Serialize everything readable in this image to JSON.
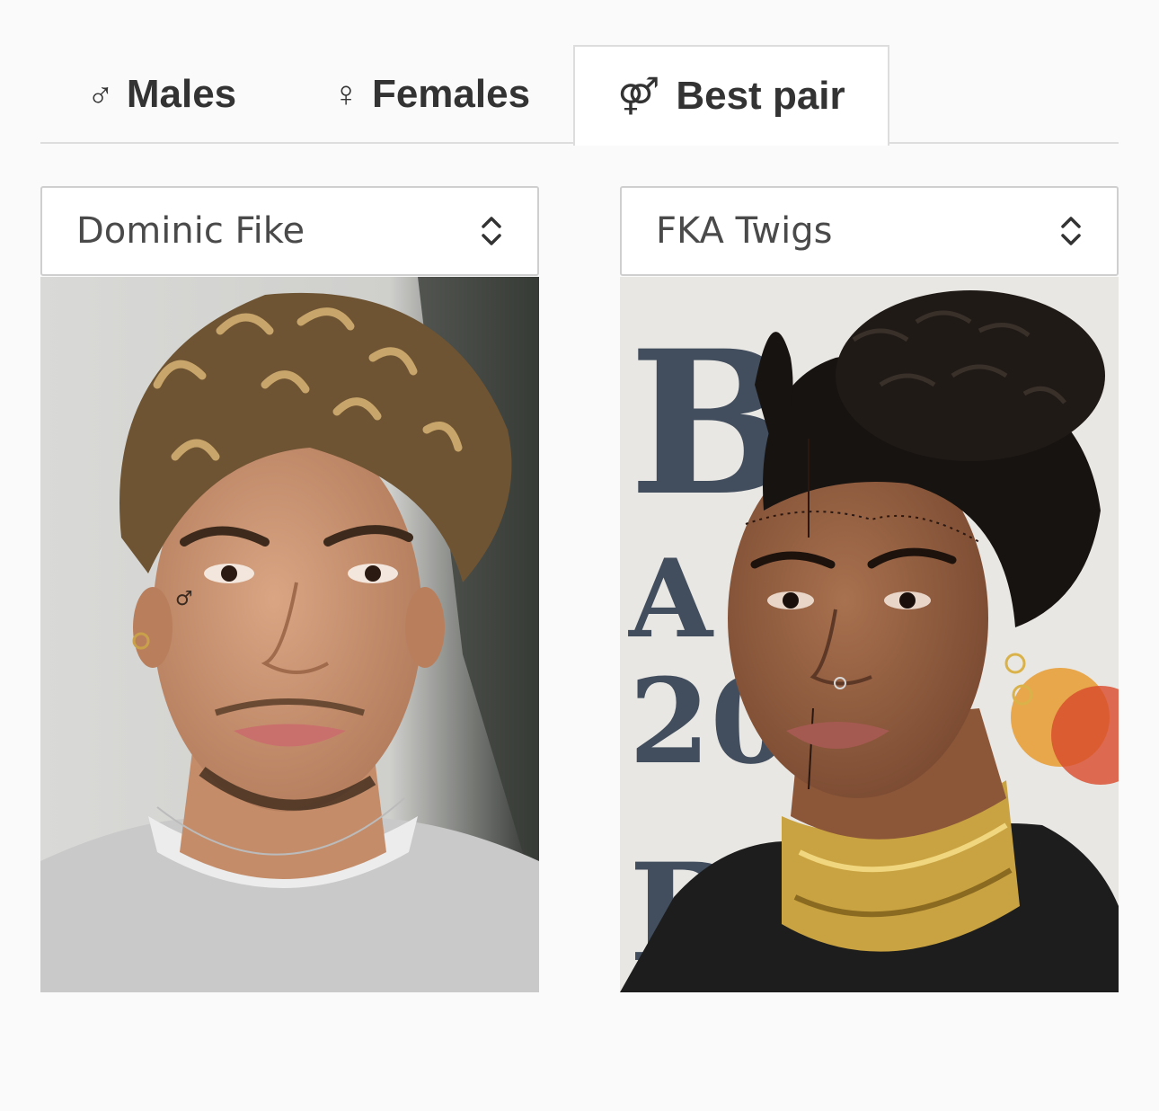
{
  "tabs": [
    {
      "symbol": "♂",
      "label": "Males"
    },
    {
      "symbol": "♀",
      "label": "Females"
    },
    {
      "symbol": "⚤",
      "label": "Best pair"
    }
  ],
  "active_tab": "Best pair",
  "left": {
    "selected": "Dominic Fike",
    "icon": "chevron-updown-icon"
  },
  "right": {
    "selected": "FKA Twigs",
    "icon": "chevron-updown-icon"
  },
  "colors": {
    "background": "#fafafa",
    "tab_text": "#333333",
    "border": "#dddddd",
    "select_text": "#4a4a4a"
  }
}
